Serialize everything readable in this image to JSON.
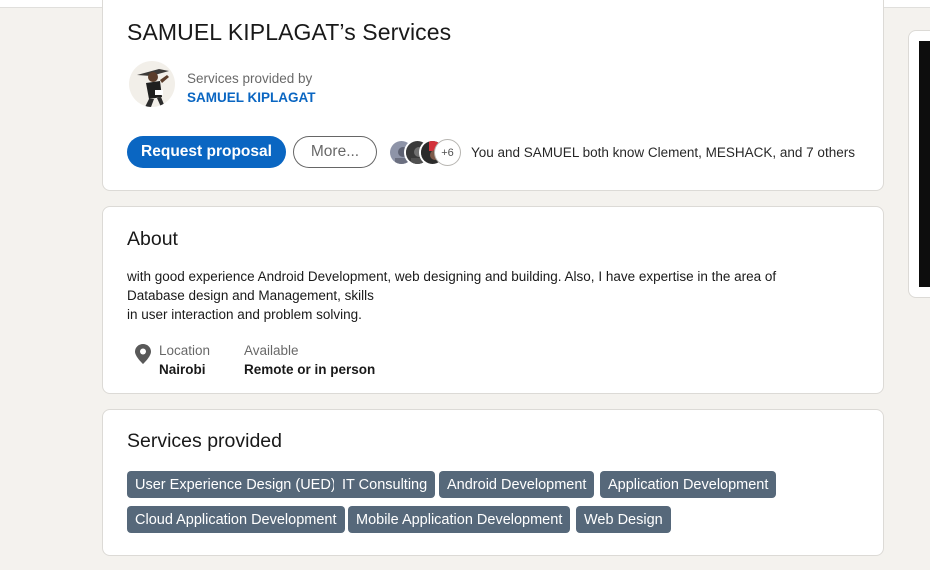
{
  "header": {
    "title": "SAMUEL KIPLAGAT’s Services",
    "provider_caption": "Services provided by",
    "provider_name": "SAMUEL KIPLAGAT",
    "request_button": "Request proposal",
    "more_button": "More...",
    "mutual_count": "+6",
    "mutual_text": "You and SAMUEL both know Clement, MESHACK, and 7 others"
  },
  "about": {
    "title": "About",
    "text": "with good experience Android Development, web designing and building. Also, I have expertise in the area of\nDatabase design and Management, skills\nin user interaction and problem solving.",
    "location_label": "Location",
    "location_value": "Nairobi",
    "availability_label": "Available",
    "availability_value": "Remote or in person"
  },
  "services": {
    "title": "Services provided",
    "items": [
      "User Experience Design (UED)",
      "IT Consulting",
      "Android Development",
      "Application Development",
      "Cloud Application Development",
      "Mobile Application Development",
      "Web Design"
    ]
  },
  "colors": {
    "accent": "#0a66c2",
    "chip_bg": "#56687a",
    "page_bg": "#f4f2ee"
  }
}
